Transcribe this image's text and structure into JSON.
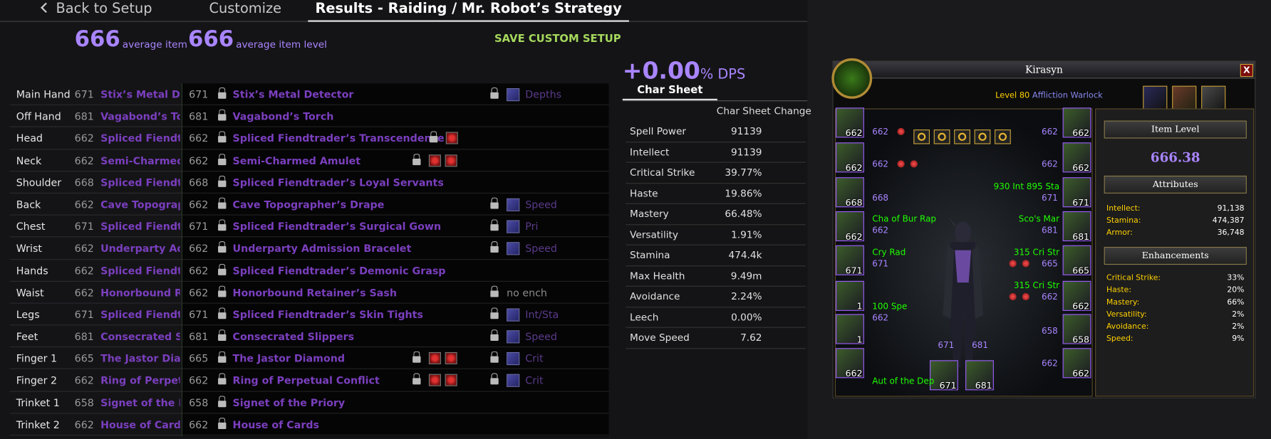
{
  "tabs": {
    "back": "Back to Setup",
    "customize": "Customize",
    "results": "Results - Raiding / Mr. Robot’s Strategy"
  },
  "ilvl": {
    "left_value": "666",
    "left_label": "average item",
    "right_value": "666",
    "right_label": "average item level"
  },
  "save_label": "SAVE CUSTOM SETUP",
  "dps": {
    "value": "+0.00",
    "unit": "% DPS"
  },
  "char_sheet": {
    "tab": "Char Sheet",
    "col1": "Char Sheet",
    "col2": "Change",
    "stats": [
      {
        "name": "Spell Power",
        "value": "91139"
      },
      {
        "name": "Intellect",
        "value": "91139"
      },
      {
        "name": "Critical Strike",
        "value": "39.77%"
      },
      {
        "name": "Haste",
        "value": "19.86%"
      },
      {
        "name": "Mastery",
        "value": "66.48%"
      },
      {
        "name": "Versatility",
        "value": "1.91%"
      },
      {
        "name": "Stamina",
        "value": "474.4k"
      },
      {
        "name": "Max Health",
        "value": "9.49m"
      },
      {
        "name": "Avoidance",
        "value": "2.24%"
      },
      {
        "name": "Leech",
        "value": "0.00%"
      },
      {
        "name": "Move Speed",
        "value": "7.62"
      }
    ]
  },
  "left_rows": [
    {
      "slot": "Main Hand",
      "lvl": "671",
      "name": "Stix’s Metal Dete"
    },
    {
      "slot": "Off Hand",
      "lvl": "681",
      "name": "Vagabond’s Torch"
    },
    {
      "slot": "Head",
      "lvl": "662",
      "name": "Spliced Fiendtrac"
    },
    {
      "slot": "Neck",
      "lvl": "662",
      "name": "Semi-Charmed A"
    },
    {
      "slot": "Shoulder",
      "lvl": "668",
      "name": "Spliced Fiendtrac"
    },
    {
      "slot": "Back",
      "lvl": "662",
      "name": "Cave Topographe"
    },
    {
      "slot": "Chest",
      "lvl": "671",
      "name": "Spliced Fiendtrac"
    },
    {
      "slot": "Wrist",
      "lvl": "662",
      "name": "Underparty Admi"
    },
    {
      "slot": "Hands",
      "lvl": "662",
      "name": "Spliced Fiendtrac"
    },
    {
      "slot": "Waist",
      "lvl": "662",
      "name": "Honorbound Ret"
    },
    {
      "slot": "Legs",
      "lvl": "671",
      "name": "Spliced Fiendtrac"
    },
    {
      "slot": "Feet",
      "lvl": "681",
      "name": "Consecrated Slip"
    },
    {
      "slot": "Finger 1",
      "lvl": "665",
      "name": "The Jastor Diamo"
    },
    {
      "slot": "Finger 2",
      "lvl": "662",
      "name": "Ring of Perpetual"
    },
    {
      "slot": "Trinket 1",
      "lvl": "658",
      "name": "Signet of the Prio"
    },
    {
      "slot": "Trinket 2",
      "lvl": "662",
      "name": "House of Cards"
    }
  ],
  "gear_rows": [
    {
      "lvl": "671",
      "name": "Stix’s Metal Detector",
      "enchant": "Depths"
    },
    {
      "lvl": "681",
      "name": "Vagabond’s Torch"
    },
    {
      "lvl": "662",
      "name": "Spliced Fiendtrader’s Transcendence"
    },
    {
      "lvl": "662",
      "name": "Semi-Charmed Amulet"
    },
    {
      "lvl": "668",
      "name": "Spliced Fiendtrader’s Loyal Servants"
    },
    {
      "lvl": "662",
      "name": "Cave Topographer’s Drape",
      "enchant": "Speed"
    },
    {
      "lvl": "671",
      "name": "Spliced Fiendtrader’s Surgical Gown",
      "enchant": "Pri"
    },
    {
      "lvl": "662",
      "name": "Underparty Admission Bracelet",
      "enchant": "Speed"
    },
    {
      "lvl": "662",
      "name": "Spliced Fiendtrader’s Demonic Grasp"
    },
    {
      "lvl": "662",
      "name": "Honorbound Retainer’s Sash",
      "enchant": "no ench"
    },
    {
      "lvl": "671",
      "name": "Spliced Fiendtrader’s Skin Tights",
      "enchant": "Int/Sta"
    },
    {
      "lvl": "681",
      "name": "Consecrated Slippers",
      "enchant": "Speed"
    },
    {
      "lvl": "665",
      "name": "The Jastor Diamond",
      "enchant": "Crit"
    },
    {
      "lvl": "662",
      "name": "Ring of Perpetual Conflict",
      "enchant": "Crit"
    },
    {
      "lvl": "658",
      "name": "Signet of the Priory"
    },
    {
      "lvl": "662",
      "name": "House of Cards"
    }
  ],
  "wow": {
    "name": "Kirasyn",
    "close": "X",
    "level": "Level 80",
    "spec": "Affliction Warlock",
    "left_slots": [
      "662",
      "662",
      "668",
      "662",
      "671",
      "1",
      "1",
      "662"
    ],
    "right_slots": [
      "662",
      "662",
      "671",
      "681",
      "665",
      "662",
      "658",
      "662"
    ],
    "bottom_slots": [
      "671",
      "681"
    ],
    "left_texts": [
      {
        "a": "662",
        "b": ""
      },
      {
        "a": "662",
        "b": ""
      },
      {
        "a": "668",
        "b": ""
      },
      {
        "a": "662",
        "b": "Cha of Bur Rap"
      },
      {
        "a": "671",
        "b": "Cry Rad"
      },
      {
        "a": "662",
        "b": "100 Spe"
      }
    ],
    "right_texts": [
      {
        "a": "662",
        "b": ""
      },
      {
        "a": "662",
        "b": ""
      },
      {
        "a": "671",
        "b": "930 Int 895 Sta"
      },
      {
        "a": "681",
        "b": "Sco's Mar"
      },
      {
        "a": "665",
        "b": "315 Cri Str"
      },
      {
        "a": "662",
        "b": "315 Cri Str"
      },
      {
        "a": "658",
        "b": ""
      },
      {
        "a": "662",
        "b": ""
      }
    ],
    "weapon_lvls": [
      "671",
      "681"
    ],
    "weapon_ench": "Aut of the Dep",
    "item_level_label": "Item Level",
    "item_level": "666.38",
    "attributes_label": "Attributes",
    "attributes": [
      {
        "k": "Intellect:",
        "v": "91,138"
      },
      {
        "k": "Stamina:",
        "v": "474,387"
      },
      {
        "k": "Armor:",
        "v": "36,748"
      }
    ],
    "enh_label": "Enhancements",
    "enhancements": [
      {
        "k": "Critical Strike:",
        "v": "33%"
      },
      {
        "k": "Haste:",
        "v": "20%"
      },
      {
        "k": "Mastery:",
        "v": "66%"
      },
      {
        "k": "Versatility:",
        "v": "2%"
      },
      {
        "k": "Avoidance:",
        "v": "2%"
      },
      {
        "k": "Speed:",
        "v": "9%"
      }
    ]
  }
}
